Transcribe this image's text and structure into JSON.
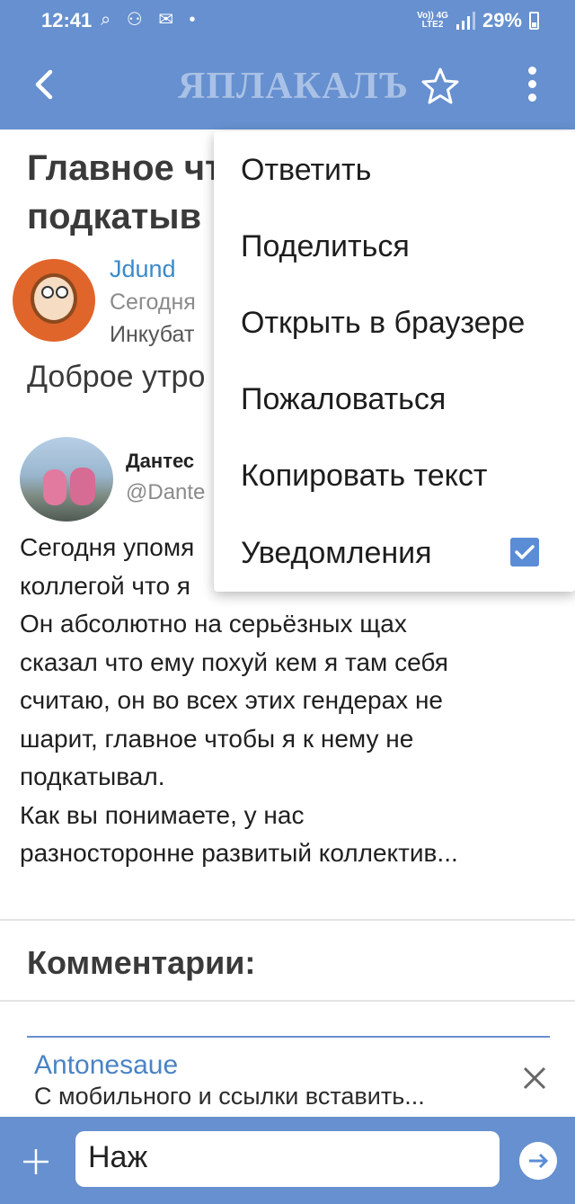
{
  "status_bar": {
    "time": "12:41",
    "network_top": "Vo)) 4G",
    "network_bottom": "LTE2",
    "battery": "29%"
  },
  "app_bar": {
    "logo_text": "ЯПЛАКАЛЪ"
  },
  "post": {
    "title_line1": "Главное чт",
    "title_line2": "подкатыв",
    "author": "Jdund",
    "date": "Сегодня",
    "rank": "Инкубат",
    "greeting": "Доброе утро"
  },
  "tweet": {
    "name": "Дантес",
    "handle": "@Dante",
    "lines": [
      "Сегодня упомя",
      "коллегой что я",
      "Он абсолютно на серьёзных щах",
      "сказал что ему похуй кем я там себя",
      "считаю, он во всех этих гендерах не",
      "шарит, главное чтобы я к нему не",
      "подкатывал.",
      "Как вы понимаете, у нас",
      "разносторонне развитый коллектив..."
    ]
  },
  "comments": {
    "heading": "Комментарии:",
    "reply_author": "Antonesaue",
    "reply_preview": "С мобильного и ссылки вставить..."
  },
  "composer": {
    "input_value": "Наж"
  },
  "menu": {
    "reply": "Ответить",
    "share": "Поделиться",
    "open_browser": "Открыть в браузере",
    "report": "Пожаловаться",
    "copy_text": "Копировать текст",
    "notifications": "Уведомления",
    "notifications_checked": true
  },
  "colors": {
    "accent": "#6690cf",
    "link": "#3c8ac8",
    "checkbox": "#5b8dd6"
  }
}
